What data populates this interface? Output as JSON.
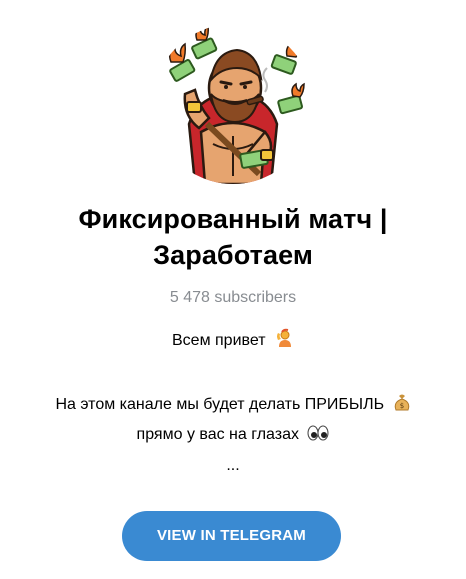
{
  "channel": {
    "title": "Фиксированный матч | Заработаем",
    "title_line1": "Фиксированный матч |",
    "title_line2": "Заработаем",
    "subscribers": "5 478 subscribers",
    "avatar_icon": "spartan-warrior-money-sticker"
  },
  "description": {
    "line1": "Всем привет",
    "line1_icon": "waving-person-emoji",
    "line2": "На этом канале мы будет делать ПРИБЫЛЬ",
    "line2_icon": "money-bag-emoji",
    "line3": "прямо у вас на глазах",
    "line3_icon": "eyes-emoji",
    "line4": "..."
  },
  "actions": {
    "view_label": "VIEW IN TELEGRAM"
  },
  "colors": {
    "button": "#3a8ad2",
    "subtle_text": "#888c91"
  }
}
